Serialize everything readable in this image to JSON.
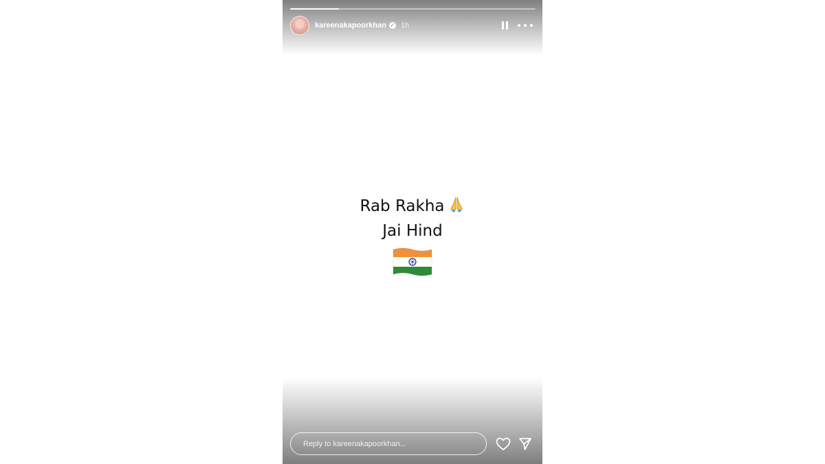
{
  "story": {
    "progress": 0.2,
    "header": {
      "username": "kareenakapoorkhan",
      "verified_icon": "verified-badge-icon",
      "time": "1h",
      "pause_icon": "pause-icon",
      "more_icon": "more-options-icon"
    },
    "content": {
      "line1": "Rab Rakha",
      "line1_emoji": "folded-hands-icon",
      "line2": "Jai Hind",
      "flag": "india-flag-icon"
    },
    "reply": {
      "placeholder": "Reply to kareenakapoorkhan..."
    },
    "actions": {
      "like_icon": "heart-icon",
      "share_icon": "send-icon"
    }
  },
  "colors": {
    "saffron": "#f0913a",
    "green": "#2e8b3a",
    "chakra": "#1f2f8a",
    "text": "#111111"
  }
}
